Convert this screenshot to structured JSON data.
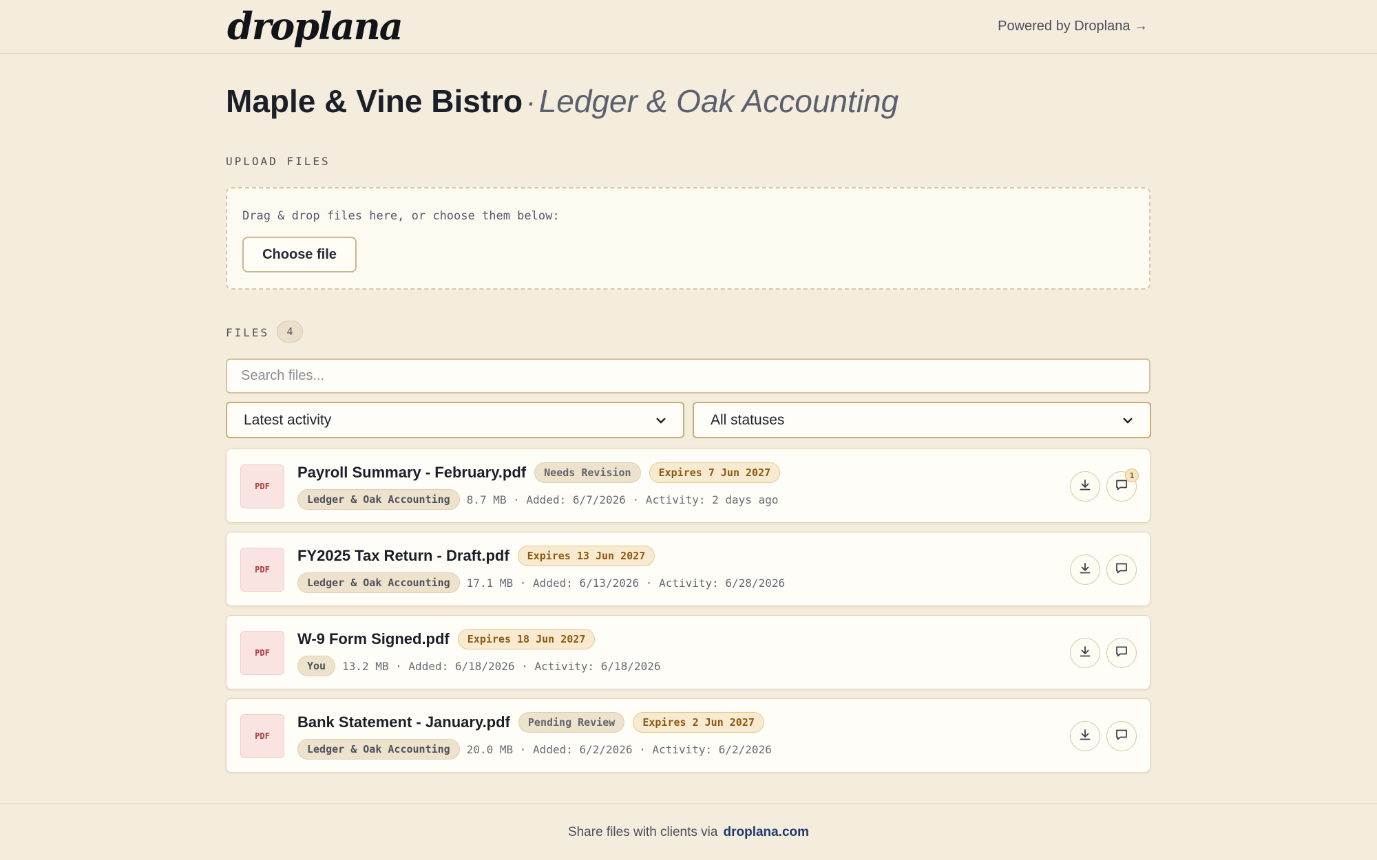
{
  "header": {
    "logo": "droplana",
    "powered_by": "Powered by Droplana →"
  },
  "title": {
    "client": "Maple & Vine Bistro",
    "separator": "·",
    "firm": "Ledger & Oak Accounting"
  },
  "upload": {
    "section_label": "UPLOAD FILES",
    "dropzone_text": "Drag & drop files here, or choose them below:",
    "choose_button": "Choose file"
  },
  "files": {
    "section_label": "FILES",
    "count": "4",
    "search_placeholder": "Search files...",
    "sort_select": "Latest activity",
    "status_select": "All statuses",
    "items": [
      {
        "type": "PDF",
        "name": "Payroll Summary - February.pdf",
        "status": "Needs Revision",
        "expires": "Expires 7 Jun 2027",
        "owner": "Ledger & Oak Accounting",
        "meta": "8.7 MB · Added: 6/7/2026 · Activity: 2 days ago",
        "comments": "1"
      },
      {
        "type": "PDF",
        "name": "FY2025 Tax Return - Draft.pdf",
        "status": "",
        "expires": "Expires 13 Jun 2027",
        "owner": "Ledger & Oak Accounting",
        "meta": "17.1 MB · Added: 6/13/2026 · Activity: 6/28/2026",
        "comments": ""
      },
      {
        "type": "PDF",
        "name": "W-9 Form Signed.pdf",
        "status": "",
        "expires": "Expires 18 Jun 2027",
        "owner": "You",
        "meta": "13.2 MB · Added: 6/18/2026 · Activity: 6/18/2026",
        "comments": ""
      },
      {
        "type": "PDF",
        "name": "Bank Statement - January.pdf",
        "status": "Pending Review",
        "expires": "Expires 2 Jun 2027",
        "owner": "Ledger & Oak Accounting",
        "meta": "20.0 MB · Added: 6/2/2026 · Activity: 6/2/2026",
        "comments": ""
      }
    ]
  },
  "footer": {
    "text": "Share files with clients via",
    "link": "droplana.com"
  }
}
